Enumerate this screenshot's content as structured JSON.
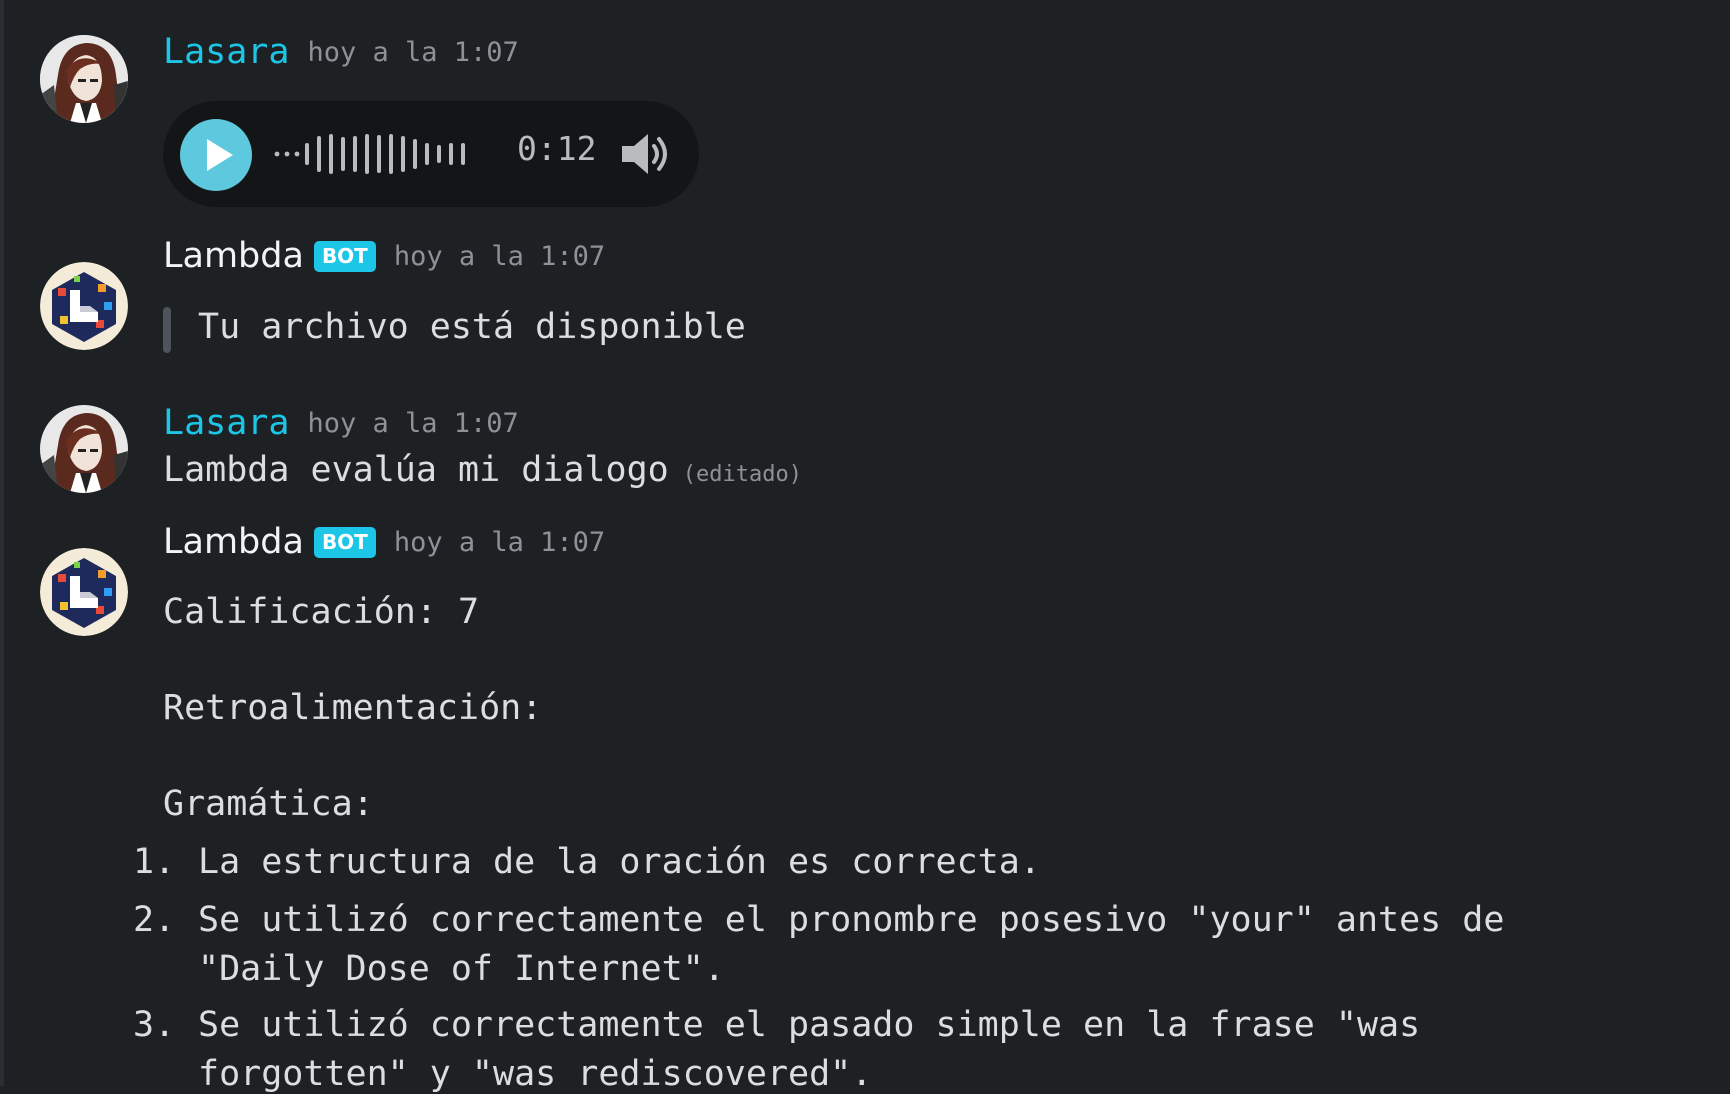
{
  "messages": [
    {
      "author": "Lasara",
      "timestamp": "hoy a la 1:07",
      "audio": {
        "duration": "0:12"
      }
    },
    {
      "author": "Lambda",
      "badge": "BOT",
      "timestamp": "hoy a la 1:07",
      "quote": "Tu archivo está disponible"
    },
    {
      "author": "Lasara",
      "timestamp": "hoy a la 1:07",
      "text": "Lambda evalúa mi dialogo",
      "edited": "(editado)"
    },
    {
      "author": "Lambda",
      "badge": "BOT",
      "timestamp": "hoy a la 1:07",
      "lines": [
        "Calificación: 7",
        "Retroalimentación:",
        "Gramática:"
      ],
      "list": [
        {
          "num": "1.",
          "lines": [
            "La estructura de la oración es correcta."
          ]
        },
        {
          "num": "2.",
          "lines": [
            "Se utilizó correctamente el pronombre posesivo \"your\" antes de",
            "\"Daily Dose of Internet\"."
          ]
        },
        {
          "num": "3.",
          "lines": [
            "Se utilizó correctamente el pasado simple en la frase \"was",
            "forgotten\" y \"was rediscovered\"."
          ]
        }
      ]
    }
  ],
  "colors": {
    "background": "#1e2124",
    "lasara_name": "#1cc6e6",
    "bot_badge": "#1cc6e6",
    "play_button": "#5ec8de"
  }
}
